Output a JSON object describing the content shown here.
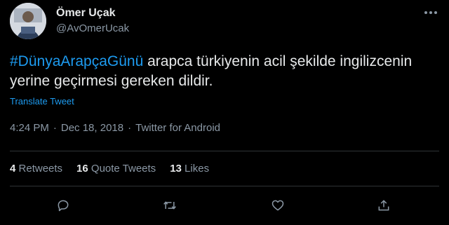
{
  "author": {
    "name": "Ömer Uçak",
    "handle": "@AvOmerUcak"
  },
  "tweet": {
    "hashtag": "#DünyaArapçaGünü",
    "text": " arapca türkiyenin acil şekilde ingilizcenin yerine geçirmesi  gereken dildir.",
    "translate_label": "Translate Tweet",
    "time": "4:24 PM",
    "date": "Dec 18, 2018",
    "separator": "·",
    "source": "Twitter for Android"
  },
  "stats": {
    "retweets_count": "4",
    "retweets_label": "Retweets",
    "quotes_count": "16",
    "quotes_label": "Quote Tweets",
    "likes_count": "13",
    "likes_label": "Likes"
  },
  "icons": {
    "more": "more-horizontal-icon",
    "reply": "reply-icon",
    "retweet": "retweet-icon",
    "like": "heart-icon",
    "share": "share-icon"
  },
  "colors": {
    "background": "#000000",
    "link": "#1d9bf0",
    "secondary_text": "#8b98a5",
    "divider": "#2f3336"
  }
}
